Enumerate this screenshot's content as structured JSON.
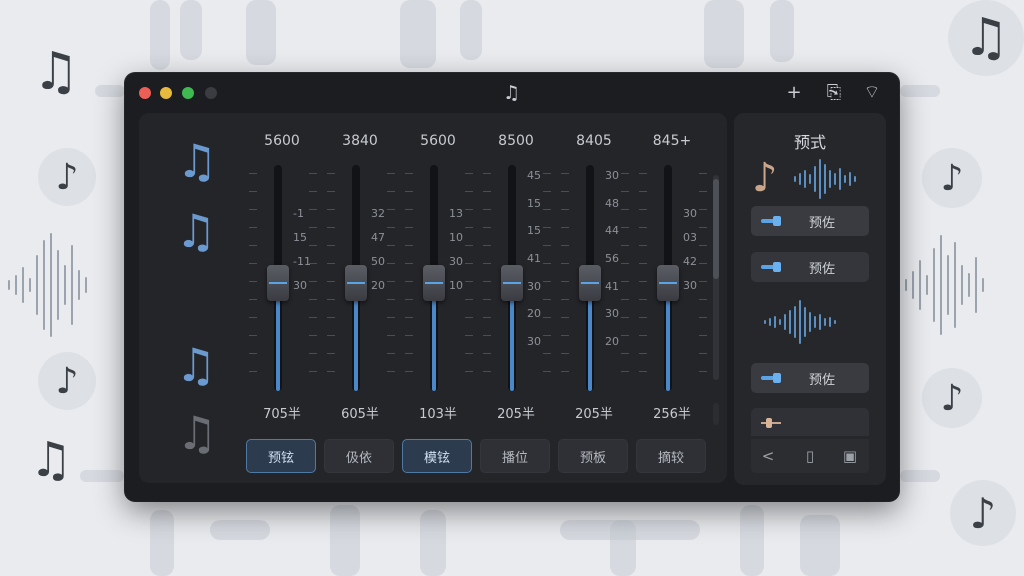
{
  "window": {
    "app_icon": "music-notes-icon"
  },
  "toolbar": {
    "icons": [
      "plus-icon",
      "export-icon",
      "wifi-icon"
    ],
    "glyphs": [
      "+",
      "⎘",
      "⌔"
    ]
  },
  "mixer": {
    "side_notes": [
      {
        "glyph": "♫",
        "color": "#6b9ad0"
      },
      {
        "glyph": "♫",
        "color": "#6b9ad0"
      },
      {
        "glyph": "♫",
        "color": "#6b9ad0"
      },
      {
        "glyph": "♫",
        "color": "#6a6d73"
      }
    ],
    "channels": [
      {
        "freq": "5600",
        "bottom": "705半",
        "preset": "预铉",
        "active": true,
        "level": 0.48,
        "scale": [
          {
            "t": "-1"
          },
          {
            "t": "15"
          },
          {
            "t": "-11"
          },
          {
            "t": "30"
          }
        ]
      },
      {
        "freq": "3840",
        "bottom": "605半",
        "preset": "伋依",
        "active": false,
        "level": 0.48,
        "scale": [
          {
            "t": "32"
          },
          {
            "t": "47"
          },
          {
            "t": "50"
          },
          {
            "t": "20"
          }
        ]
      },
      {
        "freq": "5600",
        "bottom": "103半",
        "preset": "模铉",
        "active": true,
        "level": 0.48,
        "scale": [
          {
            "t": "13"
          },
          {
            "t": "10"
          },
          {
            "t": "30"
          },
          {
            "t": "10"
          }
        ]
      },
      {
        "freq": "8500",
        "bottom": "205半",
        "preset": "播位",
        "active": false,
        "level": 0.48,
        "scale": [
          {
            "t": "45"
          },
          {
            "t": "15"
          },
          {
            "t": "15"
          },
          {
            "t": "41"
          },
          {
            "t": "30"
          },
          {
            "t": "20"
          },
          {
            "t": "30"
          }
        ]
      },
      {
        "freq": "8405",
        "bottom": "205半",
        "preset": "预板",
        "active": false,
        "level": 0.48,
        "scale": [
          {
            "t": "30"
          },
          {
            "t": "48"
          },
          {
            "t": "44"
          },
          {
            "t": "56"
          },
          {
            "t": "41"
          },
          {
            "t": "30"
          },
          {
            "t": "20"
          }
        ]
      },
      {
        "freq": "845+",
        "bottom": "256半",
        "preset": "摘较",
        "active": false,
        "level": 0.48,
        "scale": [
          {
            "t": "30"
          },
          {
            "t": "03"
          },
          {
            "t": "42"
          },
          {
            "t": "30"
          }
        ]
      }
    ]
  },
  "presets_panel": {
    "title": "预式",
    "note_icon": "music-note-icon",
    "buttons": [
      {
        "label": "预佐"
      },
      {
        "label": "预佐"
      },
      {
        "label": "预佐"
      }
    ],
    "slider_level": 0.15,
    "footer_icons": [
      "back-icon",
      "device-icon",
      "window-icon"
    ],
    "footer_glyphs": [
      "<",
      "▯",
      "▣"
    ]
  },
  "colors": {
    "accent": "#4a88c9",
    "note_warm": "#c9a58c"
  }
}
